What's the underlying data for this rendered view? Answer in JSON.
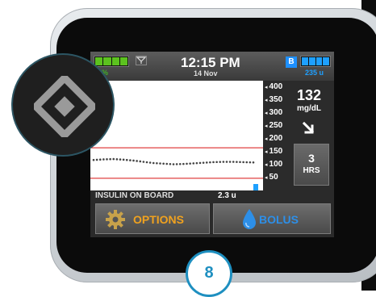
{
  "status": {
    "battery_percent": "70%",
    "time": "12:15 PM",
    "date": "14 Nov",
    "bolus_badge": "B",
    "insulin_units": "235 u"
  },
  "graph": {
    "scale": [
      "400",
      "350",
      "300",
      "250",
      "200",
      "150",
      "100",
      "50"
    ],
    "target_range": [
      80,
      180
    ],
    "cgm_trace_mgdl": [
      140,
      142,
      143,
      141,
      138,
      134,
      130,
      128,
      126,
      127,
      129,
      131,
      133,
      134,
      134,
      133,
      132
    ]
  },
  "reading": {
    "value": "132",
    "unit": "mg/dL",
    "trend_icon": "arrow-down-right-icon"
  },
  "timeframe": {
    "number": "3",
    "label": "HRS"
  },
  "iob": {
    "label": "INSULIN ON BOARD",
    "value": "2.3 u"
  },
  "buttons": {
    "options_label": "OPTIONS",
    "bolus_label": "BOLUS"
  },
  "overlay": {
    "icon": "diamond-icon",
    "step_number": "8"
  },
  "colors": {
    "battery": "#5cc21f",
    "insulin": "#1ea0ff",
    "options_text": "#f0a21f",
    "bolus_text": "#2d8fe8",
    "target_line": "#e04040",
    "accent_circle": "#1e8fc0"
  }
}
